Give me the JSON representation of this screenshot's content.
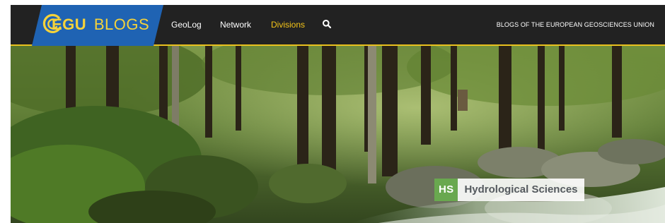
{
  "brand": {
    "logo_text_egu": "EGU",
    "logo_text_blogs": "BLOGS",
    "logo_icon": "egu-swirl-icon",
    "brand_blue": "#1f63b3",
    "brand_yellow": "#f5d23a"
  },
  "nav": {
    "items": [
      {
        "label": "GeoLog",
        "active": false
      },
      {
        "label": "Network",
        "active": false
      },
      {
        "label": "Divisions",
        "active": true
      }
    ],
    "search_icon": "search-icon",
    "tagline": "BLOGS OF THE EUROPEAN GEOSCIENCES UNION",
    "active_color": "#f5c518",
    "bar_color": "#222222"
  },
  "hero": {
    "division_abbr": "HS",
    "division_name": "Hydrological Sciences",
    "badge_color": "#69a84f"
  }
}
